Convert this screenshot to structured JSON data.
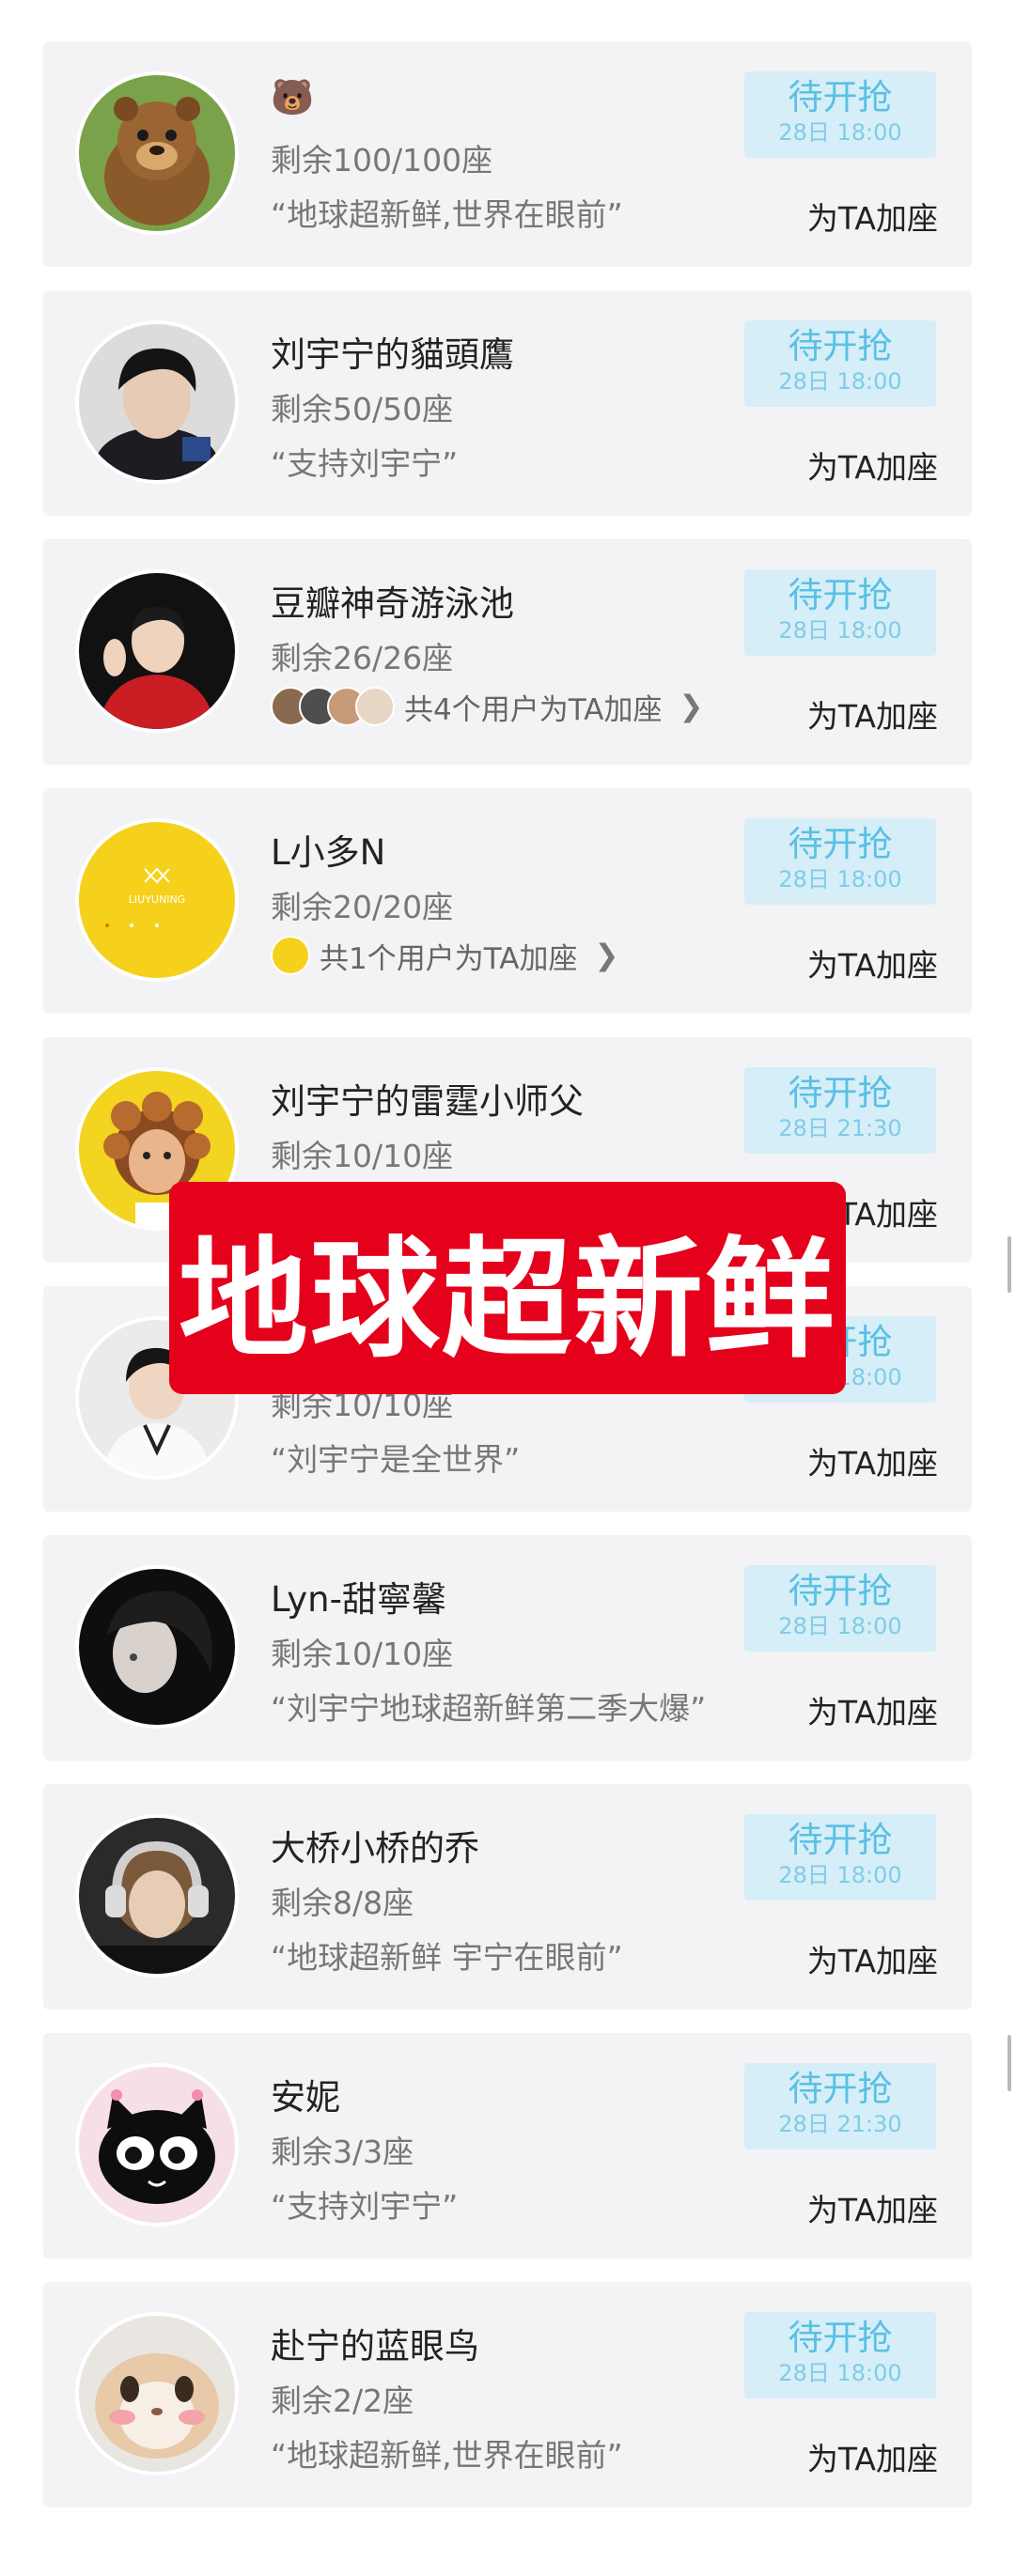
{
  "grab_label": "待开抢",
  "add_seat_label": "为TA加座",
  "cards": [
    {
      "name": "🐻",
      "seats": "剩余100/100座",
      "quote": "“地球超新鲜,世界在眼前”",
      "time": "28日 18:00",
      "avatar_desc": "bear-cartoon"
    },
    {
      "name": "刘宇宁的貓頭鷹",
      "seats": "剩余50/50座",
      "quote": "“支持刘宇宁”",
      "time": "28日 18:00",
      "avatar_desc": "man-dark-hair"
    },
    {
      "name": "豆瓣神奇游泳池",
      "seats": "剩余26/26座",
      "supporters": "共4个用户为TA加座",
      "time": "28日 18:00",
      "avatar_desc": "man-red-suit"
    },
    {
      "name": "L小多N",
      "seats": "剩余20/20座",
      "supporters": "共1个用户为TA加座",
      "time": "28日 18:00",
      "avatar_desc": "yellow-logo"
    },
    {
      "name": "刘宇宁的雷霆小师父",
      "seats": "剩余10/10座",
      "quote": "",
      "time": "28日 21:30",
      "avatar_desc": "curly-hair-figure"
    },
    {
      "name": "",
      "seats": "剩余10/10座",
      "quote": "“刘宇宁是全世界”",
      "time": "28日 18:00",
      "avatar_desc": "man-white-shirt"
    },
    {
      "name": "Lyn-甜寧馨",
      "seats": "剩余10/10座",
      "quote": "“刘宇宁地球超新鲜第二季大爆”",
      "time": "28日 18:00",
      "avatar_desc": "dark-portrait"
    },
    {
      "name": "大桥小桥的乔",
      "seats": "剩余8/8座",
      "quote": "“地球超新鲜 宇宁在眼前”",
      "time": "28日 18:00",
      "avatar_desc": "headphones-portrait"
    },
    {
      "name": "安妮",
      "seats": "剩余3/3座",
      "quote": "“支持刘宇宁”",
      "time": "28日 21:30",
      "avatar_desc": "black-cat-cartoon"
    },
    {
      "name": "赴宁的蓝眼鸟",
      "seats": "剩余2/2座",
      "quote": "“地球超新鲜,世界在眼前”",
      "time": "28日 18:00",
      "avatar_desc": "hamster-face"
    }
  ],
  "banner": {
    "text": "地球超新鲜"
  },
  "colors": {
    "card_bg": "#f3f3f5",
    "grab_bg": "#d6eef7",
    "grab_text": "#5ac0e4",
    "banner_bg": "#e5001c"
  }
}
